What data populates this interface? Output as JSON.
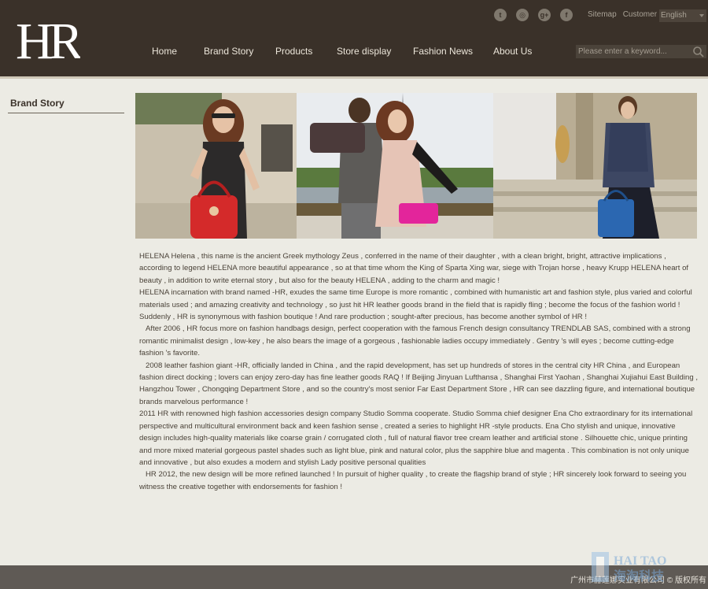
{
  "header": {
    "logo_text": "HR",
    "social": [
      {
        "icon": "twitter-icon",
        "glyph": "t"
      },
      {
        "icon": "instagram-icon",
        "glyph": "◎"
      },
      {
        "icon": "google-plus-icon",
        "glyph": "g+"
      },
      {
        "icon": "facebook-icon",
        "glyph": "f"
      }
    ],
    "sitemap_label": "Sitemap",
    "customer_label": "Customer",
    "language_selected": "English",
    "search_placeholder": "Please enter a keyword...",
    "nav": [
      "Home",
      "Brand Story",
      "Products",
      "Store display",
      "Fashion News",
      "About Us"
    ]
  },
  "sidebar": {
    "title": "Brand Story"
  },
  "article": {
    "paragraphs": [
      "HELENA Helena , this name is the ancient Greek mythology Zeus , conferred in the name of their daughter , with a clean bright, bright, attractive implications , according to legend HELENA more beautiful appearance , so at that time whom the King of Sparta Xing war, siege with Trojan horse , heavy Krupp HELENA heart of beauty , in addition to write eternal story , but also for the beauty HELENA , adding to the charm and magic !",
      "HELENA incarnation with brand named -HR, exudes the same time Europe is more romantic , combined with humanistic art and fashion style, plus varied and colorful materials used ; and amazing creativity and technology , so just hit HR leather goods brand in the field that is rapidly fling ; become the focus of the fashion world ! Suddenly , HR is synonymous with fashion boutique ! And rare production ; sought-after precious, has become another symbol of HR !",
      "After 2006 , HR focus more on fashion handbags design, perfect cooperation with the famous French design consultancy TRENDLAB SAS, combined with a strong romantic minimalist design , low-key , he also bears the image of a gorgeous , fashionable ladies occupy immediately . Gentry 's will eyes ; become cutting-edge fashion 's favorite.",
      "2008 leather fashion giant -HR, officially landed in China , and the rapid development, has set up hundreds of stores in the central city HR China , and European fashion direct docking ; lovers can enjoy zero-day has fine leather goods RAQ ! If Beijing Jinyuan Lufthansa , Shanghai First Yaohan , Shanghai Xujiahui East Building , Hangzhou Tower , Chongqing Department Store , and so the country's most senior Far East Department Store , HR can see dazzling figure, and international boutique brands marvelous performance !",
      "2011 HR with renowned high fashion accessories design company Studio Somma cooperate. Studio Somma chief designer Ena Cho extraordinary for its international perspective and multicultural environment back and keen fashion sense , created a series to highlight HR -style products. Ena Cho stylish and unique, innovative design includes high-quality materials like coarse grain / corrugated cloth , full of natural flavor tree cream leather and artificial stone . Silhouette chic, unique printing and more mixed material gorgeous pastel shades such as light blue, pink and natural color, plus the sapphire blue and magenta . This combination is not only unique and innovative , but also exudes a modern and stylish Lady positive personal qualities",
      "HR 2012, the new design will be more refined launched ! In pursuit of higher quality , to create the flagship brand of style ; HR sincerely look forward to seeing you witness the creative together with endorsements for fashion !"
    ]
  },
  "footer": {
    "text": "广州市赫莲娜实业有限公司 © 版权所有",
    "watermark_line1": "HAI TAO",
    "watermark_line2": "海淘科技"
  },
  "colors": {
    "header_bg": "#3a3129",
    "page_bg": "#ecebe4",
    "footer_bg": "#5f5a55",
    "text": "#4a4238"
  }
}
